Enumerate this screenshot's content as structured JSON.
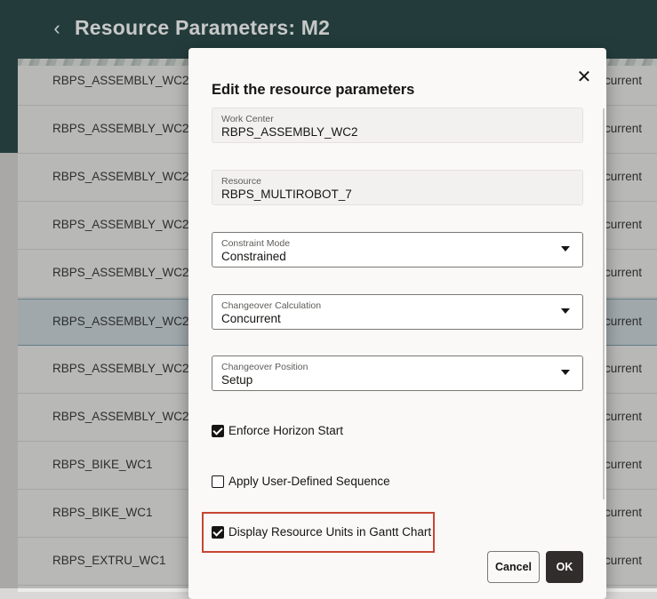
{
  "page": {
    "title": "Resource Parameters: M2",
    "back_icon": "chevron-left-icon"
  },
  "table": {
    "rows": [
      {
        "work_center": "RBPS_ASSEMBLY_WC2",
        "mode": "current"
      },
      {
        "work_center": "RBPS_ASSEMBLY_WC2",
        "mode": "current"
      },
      {
        "work_center": "RBPS_ASSEMBLY_WC2",
        "mode": "current"
      },
      {
        "work_center": "RBPS_ASSEMBLY_WC2",
        "mode": "current"
      },
      {
        "work_center": "RBPS_ASSEMBLY_WC2",
        "mode": "current"
      },
      {
        "work_center": "RBPS_ASSEMBLY_WC2",
        "mode": "current",
        "selected": true
      },
      {
        "work_center": "RBPS_ASSEMBLY_WC2",
        "mode": "current"
      },
      {
        "work_center": "RBPS_ASSEMBLY_WC2",
        "mode": "current"
      },
      {
        "work_center": "RBPS_BIKE_WC1",
        "mode": "current"
      },
      {
        "work_center": "RBPS_BIKE_WC1",
        "mode": "current"
      },
      {
        "work_center": "RBPS_EXTRU_WC1",
        "mode": "current"
      }
    ]
  },
  "dialog": {
    "title": "Edit the resource parameters",
    "close_icon": "close-icon",
    "fields": {
      "work_center": {
        "label": "Work Center",
        "value": "RBPS_ASSEMBLY_WC2"
      },
      "resource": {
        "label": "Resource",
        "value": "RBPS_MULTIROBOT_7"
      },
      "constraint_mode": {
        "label": "Constraint Mode",
        "value": "Constrained"
      },
      "changeover_calculation": {
        "label": "Changeover Calculation",
        "value": "Concurrent"
      },
      "changeover_position": {
        "label": "Changeover Position",
        "value": "Setup"
      }
    },
    "checkboxes": {
      "enforce_horizon_start": {
        "label": "Enforce Horizon Start",
        "checked": true
      },
      "apply_user_defined_sequence": {
        "label": "Apply User-Defined Sequence",
        "checked": false
      },
      "display_resource_units": {
        "label": "Display Resource Units in Gantt Chart",
        "checked": true
      }
    },
    "buttons": {
      "cancel": "Cancel",
      "ok": "OK"
    }
  },
  "colors": {
    "header_bg": "#2d4d4c",
    "highlight_border": "#c74634",
    "ok_button_bg": "#312d2a",
    "selected_row_bg": "#cdd8dd"
  }
}
